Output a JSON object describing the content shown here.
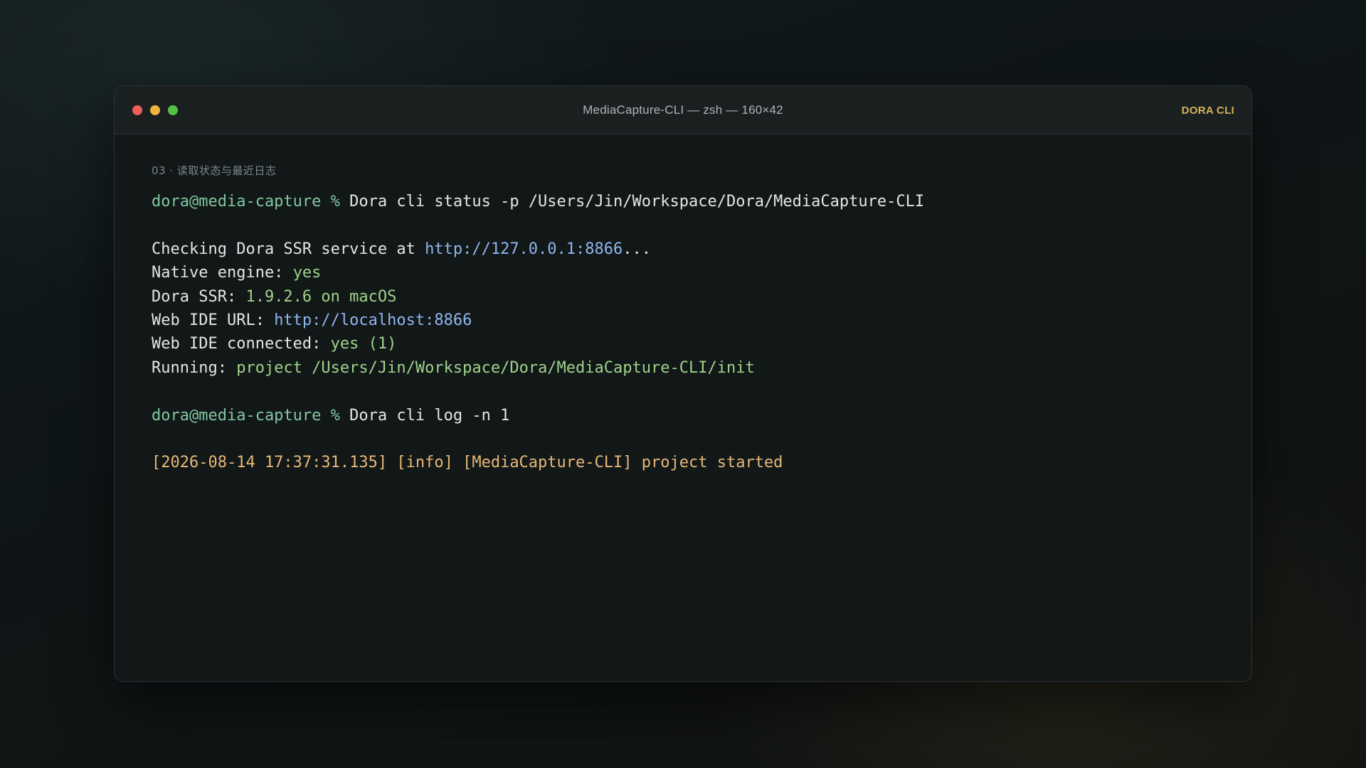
{
  "window": {
    "title": "MediaCapture-CLI — zsh — 160×42",
    "badge": "DORA CLI"
  },
  "terminal": {
    "section_label": "03 · 读取状态与最近日志",
    "cmd1": {
      "prompt": "dora@media-capture %",
      "command": "Dora cli status -p /Users/Jin/Workspace/Dora/MediaCapture-CLI"
    },
    "checking": {
      "label": "Checking Dora SSR service at ",
      "url": "http://127.0.0.1:8866",
      "suffix": "..."
    },
    "native_engine": {
      "label": "Native engine: ",
      "value": "yes"
    },
    "dora_ssr": {
      "label": "Dora SSR: ",
      "value": "1.9.2.6 on macOS"
    },
    "web_ide_url": {
      "label": "Web IDE URL: ",
      "value": "http://localhost:8866"
    },
    "web_ide_connected": {
      "label": "Web IDE connected: ",
      "value": "yes (1)"
    },
    "running": {
      "label": "Running: ",
      "value": "project /Users/Jin/Workspace/Dora/MediaCapture-CLI/init"
    },
    "cmd2": {
      "prompt": "dora@media-capture %",
      "command": "Dora cli log -n 1"
    },
    "log_line": "[2026-08-14 17:37:31.135] [info] [MediaCapture-CLI] project started"
  },
  "colors": {
    "prompt": "#80c7a0",
    "value_green": "#9fd38a",
    "url_blue": "#8fb6ee",
    "log_amber": "#e8b877",
    "badge_gold": "#d8b25a"
  }
}
